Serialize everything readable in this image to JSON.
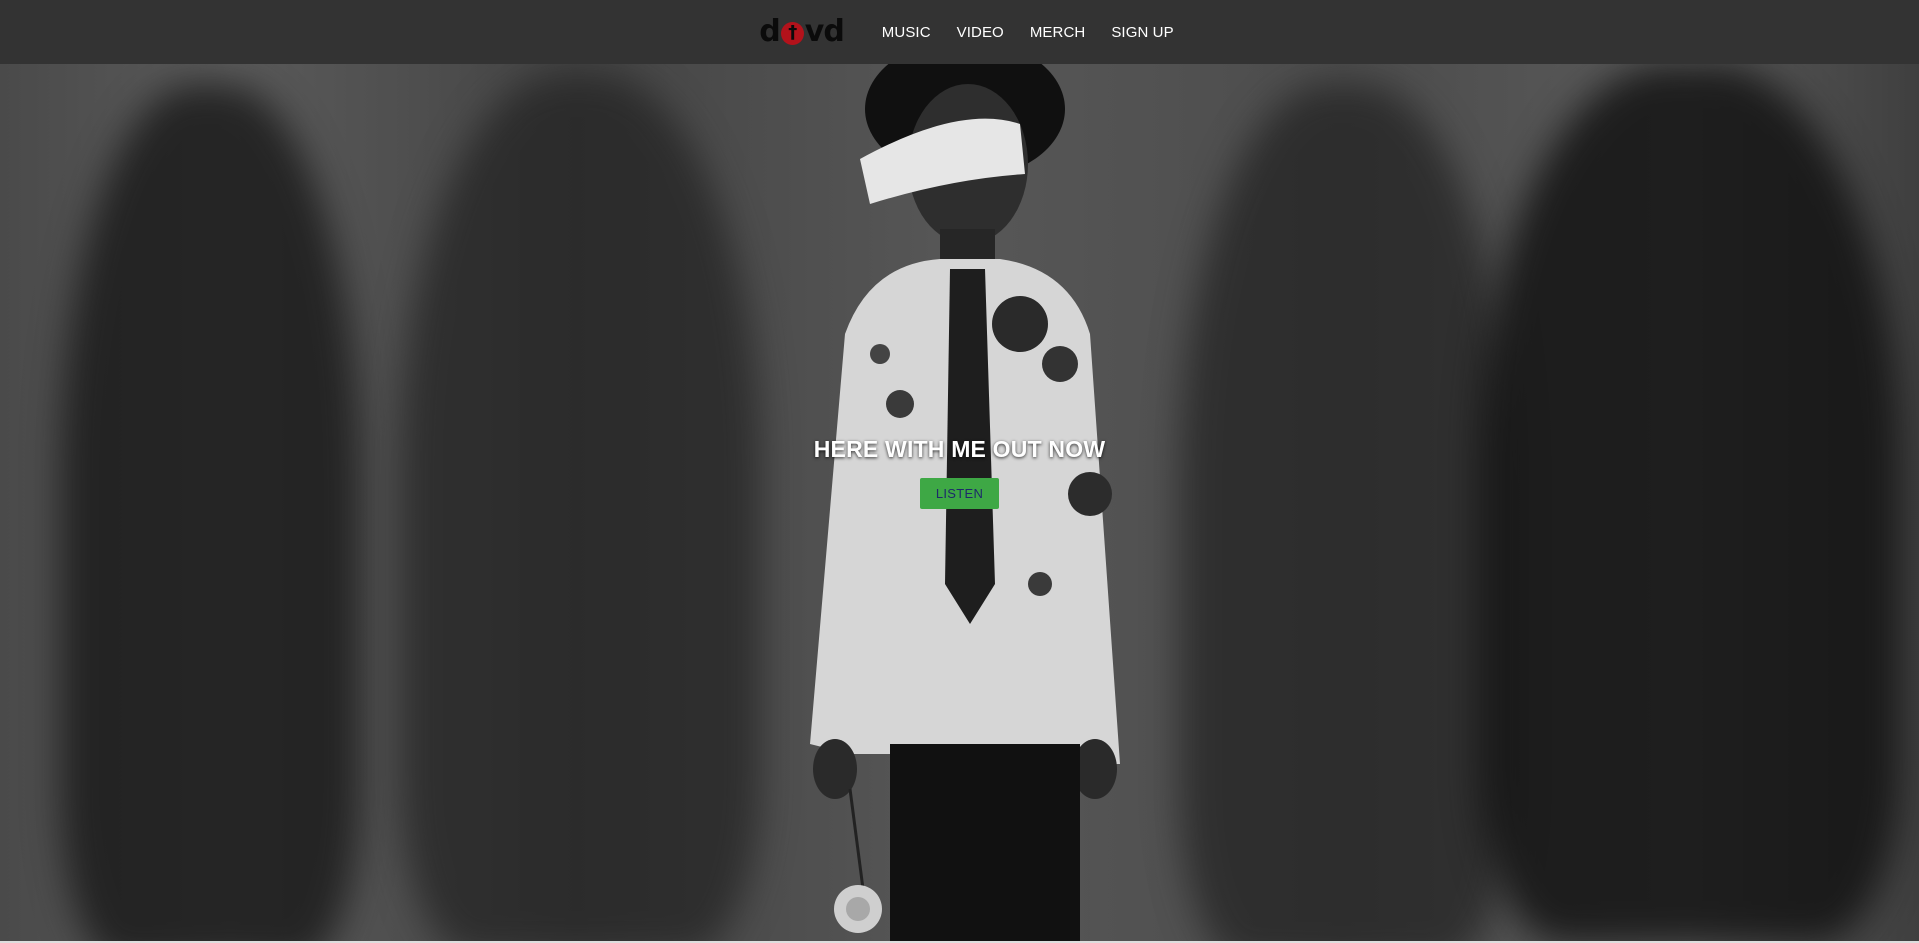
{
  "nav": {
    "logo_left": "d",
    "logo_mark": "†",
    "logo_right": "vd",
    "links": [
      {
        "label": "MUSIC"
      },
      {
        "label": "VIDEO"
      },
      {
        "label": "MERCH"
      },
      {
        "label": "SIGN UP"
      }
    ]
  },
  "hero": {
    "headline": "HERE WITH ME OUT NOW",
    "cta_label": "LISTEN",
    "cta_color": "#3ea845"
  },
  "colors": {
    "navbar_bg": "#333333",
    "logo_accent": "#b3121b"
  }
}
